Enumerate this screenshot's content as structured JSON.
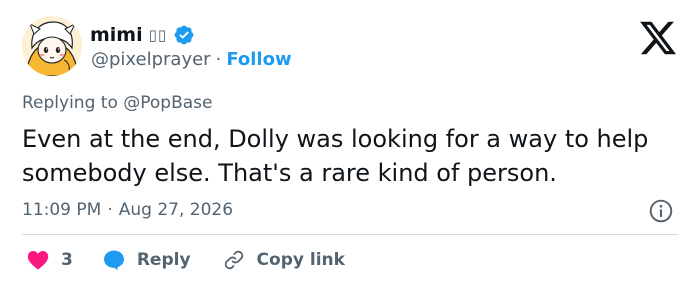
{
  "author": {
    "display_name": "mimi",
    "name_suffix": "▯▯",
    "handle": "@pixelprayer",
    "separator": "·",
    "follow_label": "Follow",
    "verified": true
  },
  "reply_context": {
    "prefix": "Replying to",
    "mention": "@PopBase"
  },
  "tweet": {
    "text": "Even at the end, Dolly was looking for a way to help somebody else. That's a rare kind of person.",
    "time": "11:09 PM",
    "separator": "·",
    "date": "Aug 27, 2026"
  },
  "actions": {
    "like_count": "3",
    "reply_label": "Reply",
    "copy_link_label": "Copy link"
  },
  "colors": {
    "accent": "#1d9bf0",
    "like": "#f91880",
    "text": "#0f1419",
    "muted": "#536471"
  },
  "icons": [
    "avatar-image",
    "verified-badge-icon",
    "x-logo-icon",
    "info-icon",
    "heart-icon",
    "reply-bubble-icon",
    "link-icon"
  ]
}
